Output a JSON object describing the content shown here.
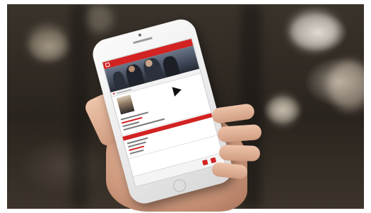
{
  "image": {
    "description_kind": "photo",
    "subject": "hand-holding-smartphone",
    "accent_color": "#d22222",
    "background_tone": "#2e2821"
  }
}
